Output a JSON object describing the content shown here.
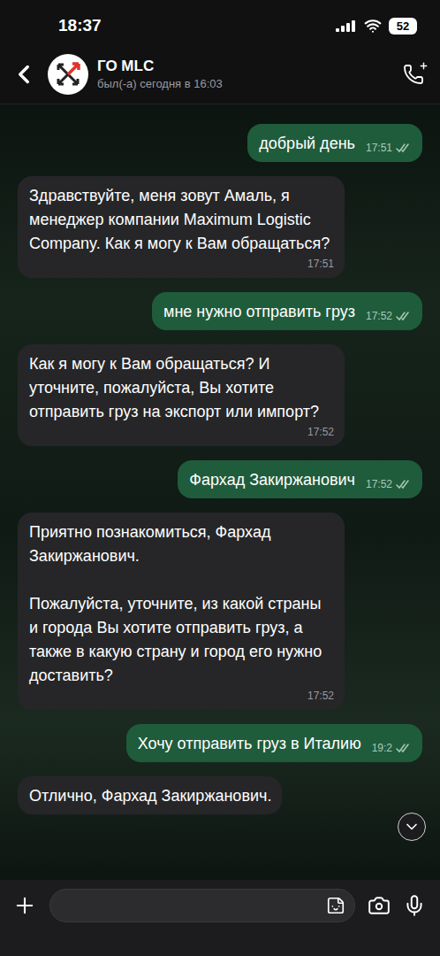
{
  "status_bar": {
    "time": "18:37",
    "battery": "52"
  },
  "header": {
    "title": "ГО MLC",
    "subtitle": "был(-а) сегодня в 16:03"
  },
  "messages": [
    {
      "kind": "outgoing",
      "text": "добрый день",
      "time": "17:51",
      "read": true
    },
    {
      "kind": "incoming",
      "text": "Здравствуйте, меня зовут Амаль, я менеджер компании Maximum Logistic Company. Как я могу к Вам обращаться?",
      "time": "17:51",
      "read": false
    },
    {
      "kind": "outgoing",
      "text": "мне нужно отправить груз",
      "time": "17:52",
      "read": true
    },
    {
      "kind": "incoming",
      "text": "Как я могу к Вам обращаться? И уточните, пожалуйста, Вы хотите отправить груз на экспорт или импорт?",
      "time": "17:52",
      "read": false
    },
    {
      "kind": "outgoing",
      "text": "Фархад Закиржанович",
      "time": "17:52",
      "read": true
    },
    {
      "kind": "incoming",
      "text": "Приятно познакомиться, Фархад Закиржанович.\n\nПожалуйста, уточните, из какой страны и города Вы хотите отправить груз, а также в какую страну и город его нужно доставить?",
      "time": "17:52",
      "read": false
    },
    {
      "kind": "outgoing",
      "text": "Хочу отправить груз в Италию",
      "time": "19:2",
      "read": true
    },
    {
      "kind": "incoming",
      "text": "Отлично, Фархад Закиржанович.",
      "read": false
    }
  ]
}
